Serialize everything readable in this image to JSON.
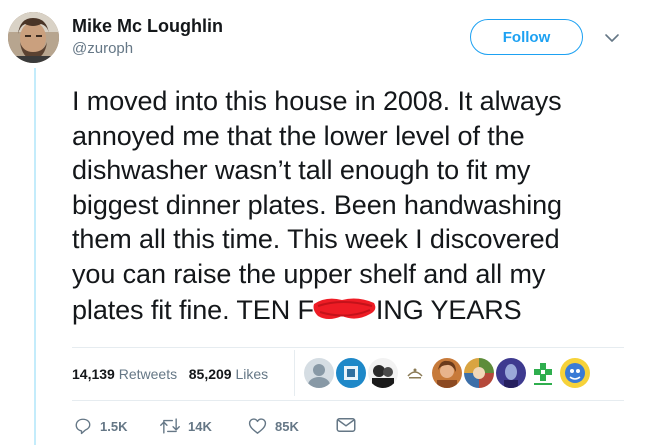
{
  "author": {
    "name": "Mike Mc Loughlin",
    "handle": "@zuroph"
  },
  "follow_label": "Follow",
  "tweet": {
    "lines": [
      "I moved into this house in 2008. It always",
      "annoyed me that the lower level of the",
      "dishwasher wasn’t tall enough to fit my",
      "biggest dinner plates. Been handwashing",
      "them all this time. This week I discovered",
      "you can raise the upper shelf and all my",
      "plates fit fine. TEN F"
    ],
    "last_line_tail": "ING YEARS",
    "redaction_color": "#ee1c25"
  },
  "stats": {
    "retweets_count": "14,139",
    "retweets_label": "Retweets",
    "likes_count": "85,209",
    "likes_label": "Likes"
  },
  "likers": [
    "default-avatar",
    "blue-square",
    "man-dark",
    "logo-script",
    "woman-orange",
    "woman-collage",
    "person-purple",
    "green-cross-logo",
    "cartoon-yellow"
  ],
  "actions": {
    "reply_count": "1.5K",
    "retweet_count": "14K",
    "like_count": "85K"
  },
  "colors": {
    "brand": "#1da1f2",
    "muted": "#657786",
    "text": "#14171a",
    "thread_line": "#c4ecfb"
  }
}
